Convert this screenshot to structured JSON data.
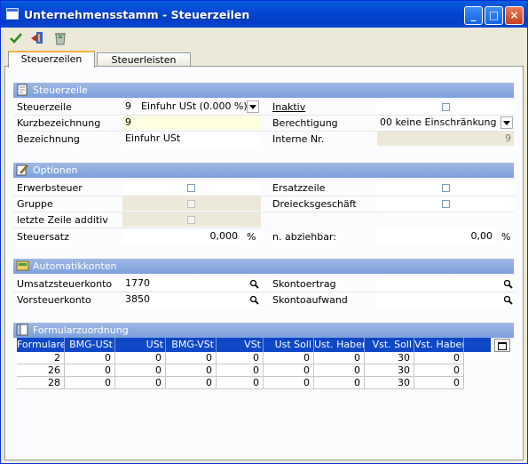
{
  "window": {
    "title": "Unternehmensstamm - Steuerzeilen",
    "minimize": "_",
    "maximize": "□",
    "close": "×"
  },
  "toolbar": {
    "items": [
      "check-icon",
      "exit-icon",
      "recycle-icon"
    ]
  },
  "tabs": [
    {
      "label": "Steuerzeilen",
      "active": true
    },
    {
      "label": "Steuerleisten",
      "active": false
    }
  ],
  "sections": {
    "steuerzeile": "Steuerzeile",
    "optionen": "Optionen",
    "automatik": "Automatikkonten",
    "formular": "Formularzuordnung"
  },
  "steuerzeile": {
    "steuerzeile_label": "Steuerzeile",
    "steuerzeile_nr": "9",
    "steuerzeile_text": "Einfuhr USt (0.000 %)",
    "kurz_label": "Kurzbezeichnung",
    "kurz_value": "9",
    "bez_label": "Bezeichnung",
    "bez_value": "Einfuhr USt",
    "inaktiv_label": "Inaktiv",
    "berecht_label": "Berechtigung",
    "berecht_value": "00 keine Einschränkung",
    "interne_label": "Interne Nr.",
    "interne_value": "9"
  },
  "optionen": {
    "erwerb_label": "Erwerbsteuer",
    "gruppe_label": "Gruppe",
    "additiv_label": "letzte Zeile additiv",
    "satz_label": "Steuersatz",
    "satz_value": "0,000",
    "satz_unit": "%",
    "ersatz_label": "Ersatzzeile",
    "dreieck_label": "Dreiecksgeschäft",
    "abzieh_label": "n. abziehbar:",
    "abzieh_value": "0,00",
    "abzieh_unit": "%"
  },
  "automatik": {
    "ust_label": "Umsatzsteuerkonto",
    "ust_value": "1770",
    "vst_label": "Vorsteuerkonto",
    "vst_value": "3850",
    "ertrag_label": "Skontoertrag",
    "ertrag_value": "",
    "aufwand_label": "Skontoaufwand",
    "aufwand_value": ""
  },
  "grid": {
    "columns": [
      "Formulare",
      "BMG-USt",
      "USt",
      "BMG-VSt",
      "VSt",
      "Ust Soll",
      "Ust. Haben",
      "Vst. Soll",
      "Vst. Haben"
    ],
    "rows": [
      [
        "2",
        "0",
        "0",
        "0",
        "0",
        "0",
        "0",
        "30",
        "0"
      ],
      [
        "26",
        "0",
        "0",
        "0",
        "0",
        "0",
        "0",
        "30",
        "0"
      ],
      [
        "28",
        "0",
        "0",
        "0",
        "0",
        "0",
        "0",
        "30",
        "0"
      ]
    ]
  },
  "colors": {
    "title_bar": "#0347d4",
    "section_bar": "#7aa0dc",
    "grid_header": "#0f47c7",
    "highlight": "#ffffe1"
  }
}
